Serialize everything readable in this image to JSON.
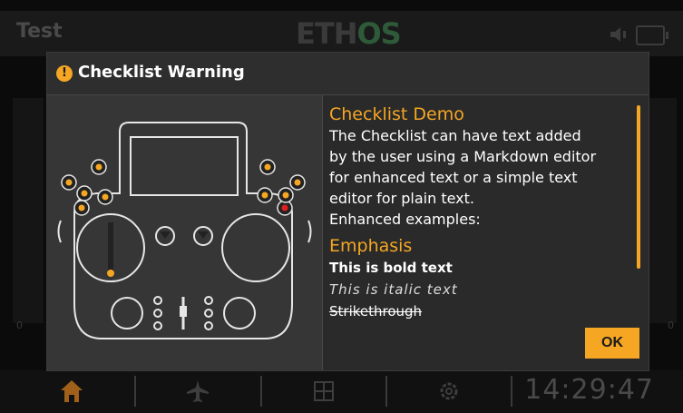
{
  "topbar": {
    "model_name": "Test",
    "brand_eth": "ETH",
    "brand_os": "OS"
  },
  "background": {
    "axis_zero_left": "0",
    "axis_zero_right": "0"
  },
  "dialog": {
    "title": "Checklist Warning",
    "icon": "warning-icon",
    "accent_color": "#f5a623",
    "content": {
      "heading1": "Checklist Demo",
      "paragraph_lines": [
        "The Checklist can have text added",
        "by the user using a Markdown editor",
        "for enhanced text or a simple text",
        "editor for plain text.",
        "Enhanced examples:"
      ],
      "heading2": "Emphasis",
      "bold_example": "This is bold text",
      "italic_example": "This is italic text",
      "strike_example": "Strikethrough"
    },
    "ok_label": "OK"
  },
  "bottombar": {
    "items": [
      "home-icon",
      "airplane-icon",
      "layout-icon",
      "gear-icon"
    ],
    "clock": "14:29:47"
  }
}
